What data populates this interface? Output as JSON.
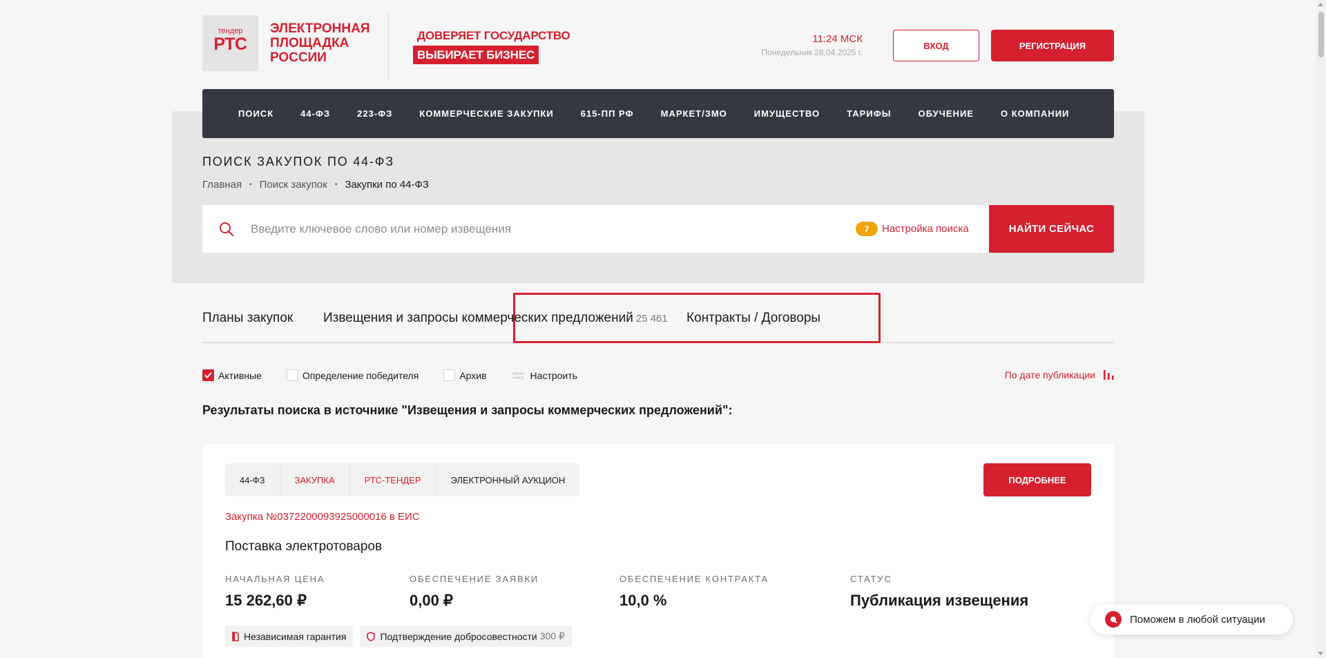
{
  "header": {
    "logo_small": "тендер",
    "logo_big": "РТС",
    "logo_text": "ЭЛЕКТРОННАЯ ПЛОЩАДКА РОССИИ",
    "tagline1": "ДОВЕРЯЕТ ГОСУДАРСТВО",
    "tagline2": "ВЫБИРАЕТ БИЗНЕС",
    "time": "11:24 МСК",
    "date": "Понедельник 28.04.2025 г.",
    "login_label": "ВХОД",
    "register_label": "РЕГИСТРАЦИЯ"
  },
  "nav": {
    "items": [
      "ПОИСК",
      "44-ФЗ",
      "223-ФЗ",
      "КОММЕРЧЕСКИЕ ЗАКУПКИ",
      "615-ПП РФ",
      "МАРКЕТ/ЗМО",
      "ИМУЩЕСТВО",
      "ТАРИФЫ",
      "ОБУЧЕНИЕ",
      "О КОМПАНИИ"
    ]
  },
  "page": {
    "title": "ПОИСК ЗАКУПОК ПО 44-ФЗ",
    "breadcrumb": [
      "Главная",
      "Поиск закупок",
      "Закупки по 44-ФЗ"
    ],
    "breadcrumb_sep": "•"
  },
  "search": {
    "placeholder": "Введите ключевое слово или номер извещения",
    "value": "",
    "settings_count": "7",
    "settings_label": "Настройка поиска",
    "button_label": "НАЙТИ СЕЙЧАС"
  },
  "tabs": {
    "plans": "Планы закупок",
    "notices": "Извещения и запросы коммерческих предложений",
    "notices_count": "25 461",
    "contracts": "Контракты / Договоры"
  },
  "filters": {
    "active": "Активные",
    "active_checked": true,
    "winner": "Определение победителя",
    "archive": "Архив",
    "configure": "Настроить",
    "sort_label": "По дате публикации"
  },
  "results": {
    "title": "Результаты поиска в источнике \"Извещения и запросы коммерческих предложений\":"
  },
  "card": {
    "tags": [
      "44-ФЗ",
      "ЗАКУПКА",
      "РТС-ТЕНДЕР",
      "ЭЛЕКТРОННЫЙ АУКЦИОН"
    ],
    "more_label": "ПОДРОБНЕЕ",
    "eis_link": "Закупка №0372200093925000016 в ЕИС",
    "title": "Поставка электротоваров",
    "metrics": [
      {
        "label": "НАЧАЛЬНАЯ ЦЕНА",
        "value": "15 262,60 ₽"
      },
      {
        "label": "ОБЕСПЕЧЕНИЕ ЗАЯВКИ",
        "value": "0,00 ₽"
      },
      {
        "label": "ОБЕСПЕЧЕНИЕ КОНТРАКТА",
        "value": "10,0 %"
      },
      {
        "label": "СТАТУС",
        "value": "Публикация извещения"
      }
    ],
    "chip_guarantee": "Независимая гарантия",
    "chip_confirm": "Подтверждение добросовестности",
    "chip_confirm_price": "300 ₽"
  },
  "help": {
    "label": "Поможем в любой ситуации"
  },
  "colors": {
    "brand_red": "#d6202f",
    "nav_dark": "#353841",
    "badge_orange": "#f0a30a"
  }
}
